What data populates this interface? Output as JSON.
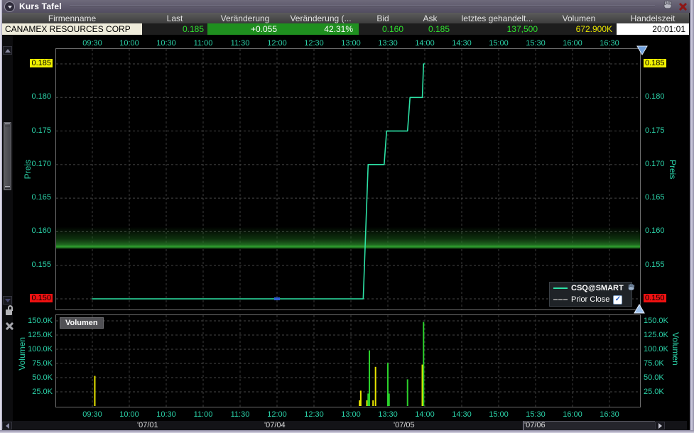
{
  "window": {
    "title": "Kurs Tafel",
    "icons": {
      "collapse": "chevron-down",
      "move": "hand",
      "close": "x",
      "detach": "unlock",
      "remove": "x"
    }
  },
  "quote_table": {
    "headers": [
      {
        "label": "Firmenname"
      },
      {
        "label": "Last"
      },
      {
        "label": "Veränderung"
      },
      {
        "label": "Veränderung (..."
      },
      {
        "label": "Bid"
      },
      {
        "label": "Ask"
      },
      {
        "label": "letztes gehandelt..."
      },
      {
        "label": "Volumen"
      },
      {
        "label": "Handelszeit"
      }
    ],
    "row": {
      "firmenname": "CANAMEX RESOURCES CORP",
      "last": "0.185",
      "change": "+0.055",
      "change_pct": "42.31%",
      "bid": "0.160",
      "ask": "0.185",
      "last_size": "137,500",
      "volume": "672.900K",
      "handelszeit": "20:01:01"
    }
  },
  "chart_data": {
    "type": "line",
    "title": "CSQ@SMART",
    "x_axis": {
      "labels": [
        "09:30",
        "10:00",
        "10:30",
        "11:00",
        "11:30",
        "12:00",
        "12:30",
        "13:00",
        "13:30",
        "14:00",
        "14:30",
        "15:00",
        "15:30",
        "16:00",
        "16:30"
      ]
    },
    "dates": [
      "'07/01",
      "'07/04",
      "'07/05",
      "'07/06"
    ],
    "price_axis": {
      "label": "Preis",
      "ticks": [
        0.185,
        0.18,
        0.175,
        0.17,
        0.165,
        0.16,
        0.155,
        0.15
      ],
      "min": 0.15,
      "max": 0.185,
      "last_price": 0.185,
      "session_low": 0.15
    },
    "volume_axis": {
      "label": "Volumen",
      "max": 150000,
      "ticks": [
        {
          "v": 150000,
          "label": "150.0K"
        },
        {
          "v": 125000,
          "label": "125.0K"
        },
        {
          "v": 100000,
          "label": "100.0K"
        },
        {
          "v": 75000,
          "label": "75.0K"
        },
        {
          "v": 50000,
          "label": "50.0K"
        },
        {
          "v": 25000,
          "label": "25.0K"
        }
      ]
    },
    "series": [
      {
        "name": "CSQ@SMART",
        "color": "#2de2a6",
        "points": [
          [
            "09:30",
            0.15
          ],
          [
            "13:10",
            0.15
          ],
          [
            "13:14",
            0.17
          ],
          [
            "13:27",
            0.17
          ],
          [
            "13:29",
            0.175
          ],
          [
            "13:46",
            0.175
          ],
          [
            "13:48",
            0.18
          ],
          [
            "13:58",
            0.18
          ],
          [
            "13:59",
            0.185
          ],
          [
            "14:00",
            0.185
          ]
        ]
      },
      {
        "name": "Prior Close",
        "style": "dashed",
        "color": "#9a9a9a",
        "level": 0.158
      }
    ],
    "marker": {
      "time": "12:00",
      "price": 0.15,
      "color": "#2f5fd4"
    },
    "volume_bars": [
      {
        "time": "09:32",
        "value": 53000,
        "color": "#e8e500"
      },
      {
        "time": "13:07",
        "value": 10000,
        "color": "#e8e500"
      },
      {
        "time": "13:08",
        "value": 27000,
        "color": "#e8e500"
      },
      {
        "time": "13:13",
        "value": 10000,
        "color": "#e8e500"
      },
      {
        "time": "13:14",
        "value": 22000,
        "color": "#2bd12b"
      },
      {
        "time": "13:15",
        "value": 98000,
        "color": "#2bd12b"
      },
      {
        "time": "13:18",
        "value": 10000,
        "color": "#e8e500"
      },
      {
        "time": "13:20",
        "value": 69000,
        "color": "#e8e500"
      },
      {
        "time": "13:30",
        "value": 76000,
        "color": "#2bd12b"
      },
      {
        "time": "13:31",
        "value": 22000,
        "color": "#2bd12b"
      },
      {
        "time": "13:46",
        "value": 47000,
        "color": "#2bd12b"
      },
      {
        "time": "13:58",
        "value": 73000,
        "color": "#e8e500"
      },
      {
        "time": "13:59",
        "value": 148000,
        "color": "#2bd12b"
      }
    ],
    "legend": [
      {
        "label": "CSQ@SMART",
        "swatch": "line"
      },
      {
        "label": "Prior Close",
        "swatch": "dashed",
        "checked": true,
        "checkbox_glyph": "✓"
      }
    ],
    "volume_title": "Volumen",
    "grid": true,
    "legend_position": "bottom-right"
  }
}
